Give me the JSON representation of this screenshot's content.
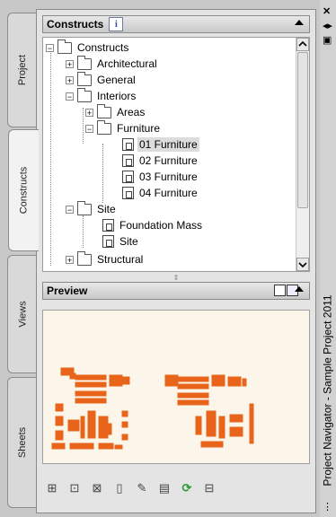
{
  "tabs": [
    "Project",
    "Constructs",
    "Views",
    "Sheets"
  ],
  "constructs_panel": {
    "title": "Constructs",
    "info": "i"
  },
  "tree": [
    {
      "label": "Constructs",
      "pm": "−",
      "icon": "folder-open"
    },
    {
      "label": "Architectural",
      "pm": "+",
      "icon": "folder"
    },
    {
      "label": "General",
      "pm": "+",
      "icon": "folder"
    },
    {
      "label": "Interiors",
      "pm": "−",
      "icon": "folder-open"
    },
    {
      "label": "Areas",
      "pm": "+",
      "icon": "folder"
    },
    {
      "label": "Furniture",
      "pm": "−",
      "icon": "folder-open"
    },
    {
      "label": "01 Furniture",
      "icon": "construct-doc",
      "selected": true
    },
    {
      "label": "02 Furniture",
      "icon": "construct-doc"
    },
    {
      "label": "03 Furniture",
      "icon": "construct-doc"
    },
    {
      "label": "04 Furniture",
      "icon": "construct-doc"
    },
    {
      "label": "Site",
      "pm": "−",
      "icon": "folder-open"
    },
    {
      "label": "Foundation Mass",
      "icon": "construct-doc"
    },
    {
      "label": "Site",
      "icon": "construct-doc"
    },
    {
      "label": "Structural",
      "pm": "+",
      "icon": "folder"
    }
  ],
  "preview_panel": {
    "title": "Preview"
  },
  "palette_title": "Project Navigator - Sample Project 2011",
  "close_glyph": "✕",
  "colors": {
    "preview_bg": "#fbf6e9",
    "drawing": "#e8641a"
  }
}
